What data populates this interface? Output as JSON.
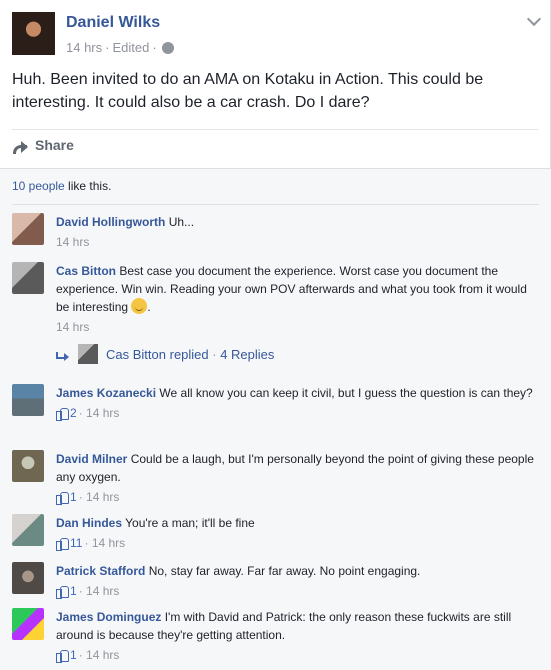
{
  "post": {
    "author": "Daniel Wilks",
    "time": "14 hrs",
    "edited": "Edited",
    "meta_separator": "·",
    "text": "Huh. Been invited to do an AMA on Kotaku in Action. This could be interesting. It could also be a car crash. Do I dare?",
    "share_label": "Share"
  },
  "likes": {
    "count_label": "10 people",
    "suffix": " like this."
  },
  "comments": [
    {
      "name": "David Hollingworth",
      "text": "Uh...",
      "time": "14 hrs"
    },
    {
      "name": "Cas Bitton",
      "text": "Best case you document the experience. Worst case you document the experience. Win win. Reading your own POV afterwards and what you took from it would be interesting",
      "text_end": ".",
      "time": "14 hrs",
      "reply_author": "Cas Bitton",
      "reply_action": "replied",
      "reply_count": "4 Replies",
      "reply_separator": " · "
    },
    {
      "name": "James Kozanecki",
      "text": "We all know you can keep it civil, but I guess the question is can they?",
      "likes": "2",
      "time": "14 hrs"
    },
    {
      "name": "David Milner",
      "text": "Could be a laugh, but I'm personally beyond the point of giving these people any oxygen.",
      "likes": "1",
      "time": "14 hrs"
    },
    {
      "name": "Dan Hindes",
      "text": "You're a man; it'll be fine",
      "likes": "11",
      "time": "14 hrs"
    },
    {
      "name": "Patrick Stafford",
      "text": "No, stay far away. Far far away. No point engaging.",
      "likes": "1",
      "time": "14 hrs"
    },
    {
      "name": "James Dominguez",
      "text": "I'm with David and Patrick: the only reason these fuckwits are still around is because they're getting attention.",
      "likes": "1",
      "time": "14 hrs"
    }
  ]
}
